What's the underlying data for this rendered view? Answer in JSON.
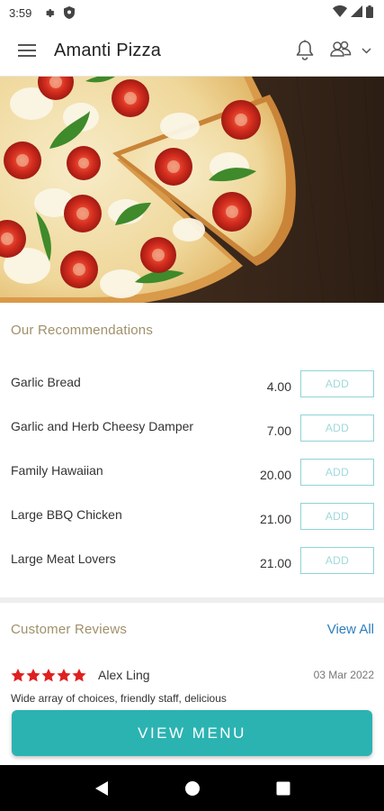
{
  "status_bar": {
    "time": "3:59",
    "icons": [
      "settings-icon",
      "shield-icon",
      "wifi-icon",
      "signal-icon",
      "battery-icon"
    ]
  },
  "app_bar": {
    "title": "Amanti Pizza",
    "icons": [
      "hamburger-menu-icon",
      "bell-icon",
      "users-icon",
      "chevron-down-icon"
    ]
  },
  "hero": {
    "image": "pizza-image"
  },
  "recommendations": {
    "title": "Our Recommendations",
    "add_label": "ADD",
    "items": [
      {
        "name": "Garlic Bread",
        "price": "4.00"
      },
      {
        "name": "Garlic and Herb Cheesy Damper",
        "price": "7.00"
      },
      {
        "name": "Family Hawaiian",
        "price": "20.00"
      },
      {
        "name": "Large BBQ Chicken",
        "price": "21.00"
      },
      {
        "name": "Large Meat Lovers",
        "price": "21.00"
      }
    ]
  },
  "reviews": {
    "title": "Customer Reviews",
    "view_all": "View All",
    "items": [
      {
        "rating": 5,
        "name": "Alex Ling",
        "date": "03 Mar 2022",
        "text": "Wide array of choices, friendly staff, delicious"
      }
    ]
  },
  "cta": {
    "label": "VIEW MENU"
  },
  "nav_bar": {
    "icons": [
      "back-icon",
      "home-icon",
      "recents-icon"
    ]
  },
  "colors": {
    "accent": "#2bb3b2",
    "section_title": "#a0906a",
    "link": "#2d7fbf",
    "star": "#e02020",
    "add_border": "#8fd3d6"
  }
}
